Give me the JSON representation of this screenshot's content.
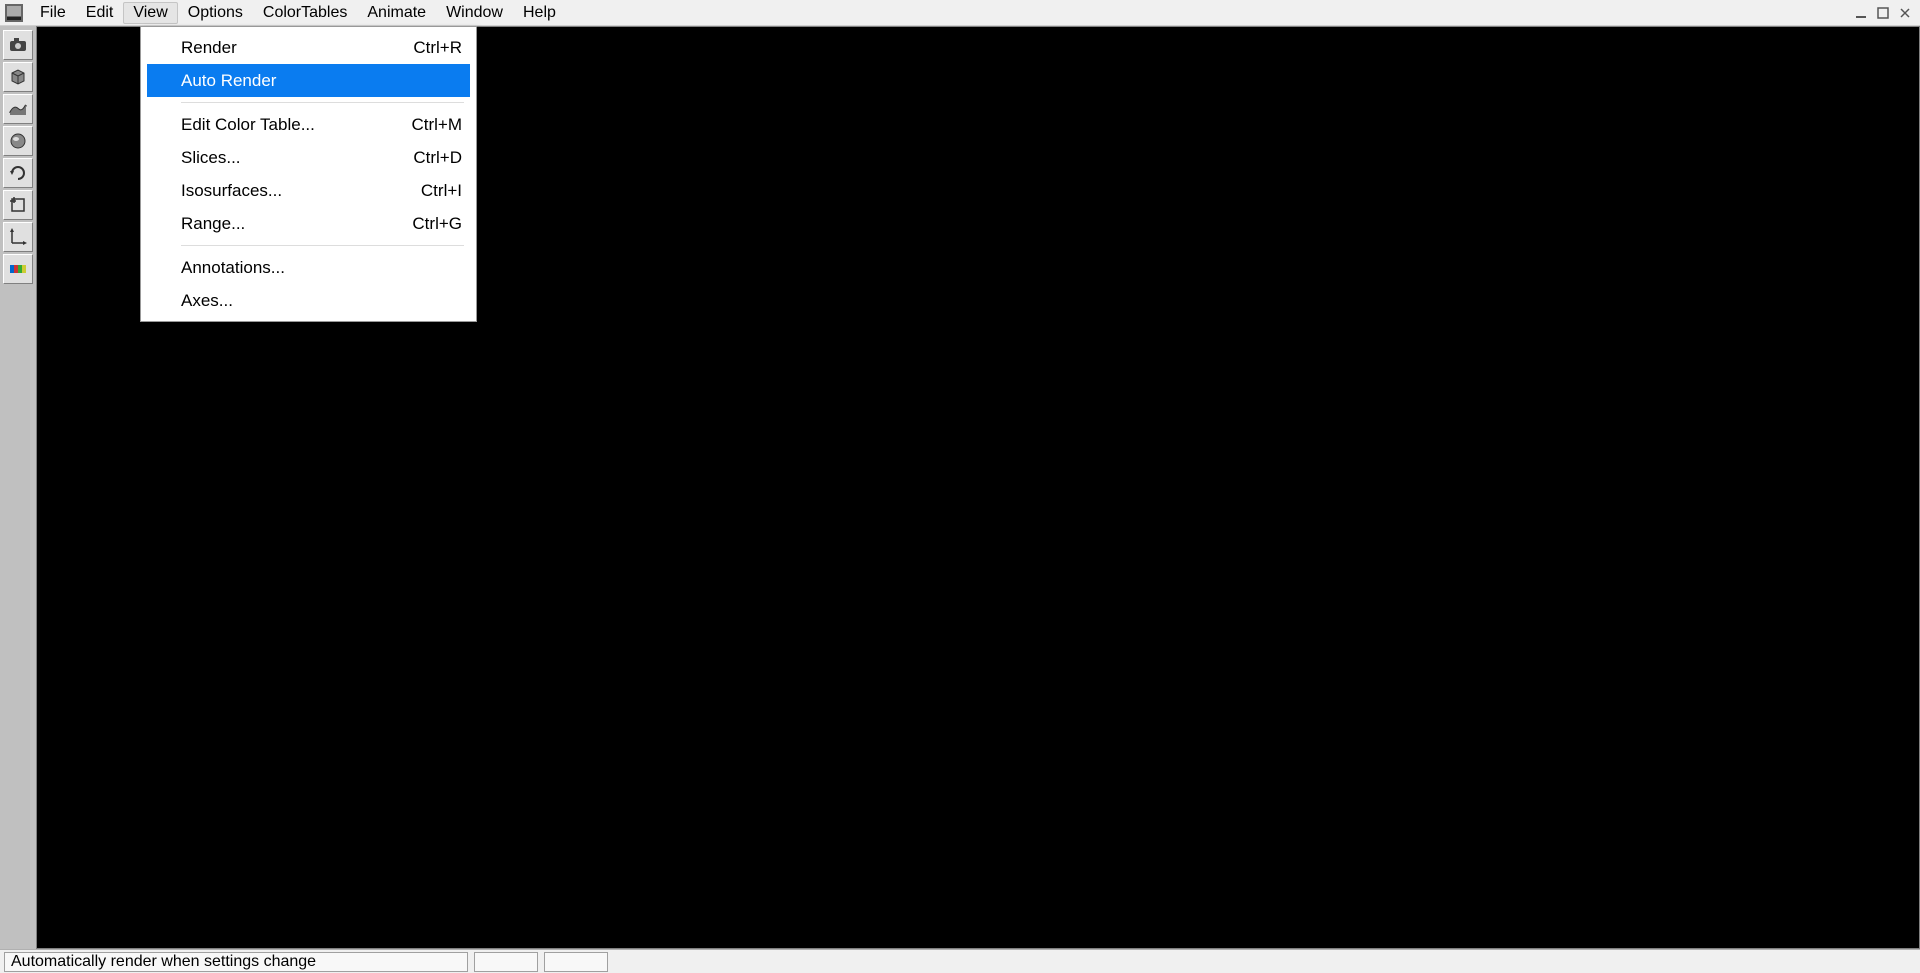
{
  "menubar": {
    "items": [
      "File",
      "Edit",
      "View",
      "Options",
      "ColorTables",
      "Animate",
      "Window",
      "Help"
    ],
    "active_index": 2
  },
  "dropdown": {
    "groups": [
      [
        {
          "label": "Render",
          "shortcut": "Ctrl+R",
          "highlight": false
        },
        {
          "label": "Auto Render",
          "shortcut": "",
          "highlight": true
        }
      ],
      [
        {
          "label": "Edit Color Table...",
          "shortcut": "Ctrl+M",
          "highlight": false
        },
        {
          "label": "Slices...",
          "shortcut": "Ctrl+D",
          "highlight": false
        },
        {
          "label": "Isosurfaces...",
          "shortcut": "Ctrl+I",
          "highlight": false
        },
        {
          "label": "Range...",
          "shortcut": "Ctrl+G",
          "highlight": false
        }
      ],
      [
        {
          "label": "Annotations...",
          "shortcut": "",
          "highlight": false
        },
        {
          "label": "Axes...",
          "shortcut": "",
          "highlight": false
        }
      ]
    ]
  },
  "toolbar": {
    "icons": [
      "camera-icon",
      "cube-icon",
      "slice-icon",
      "sphere-icon",
      "rotate-icon",
      "crop-icon",
      "axes-icon",
      "color-icon"
    ]
  },
  "statusbar": {
    "text": "Automatically render when settings change"
  }
}
